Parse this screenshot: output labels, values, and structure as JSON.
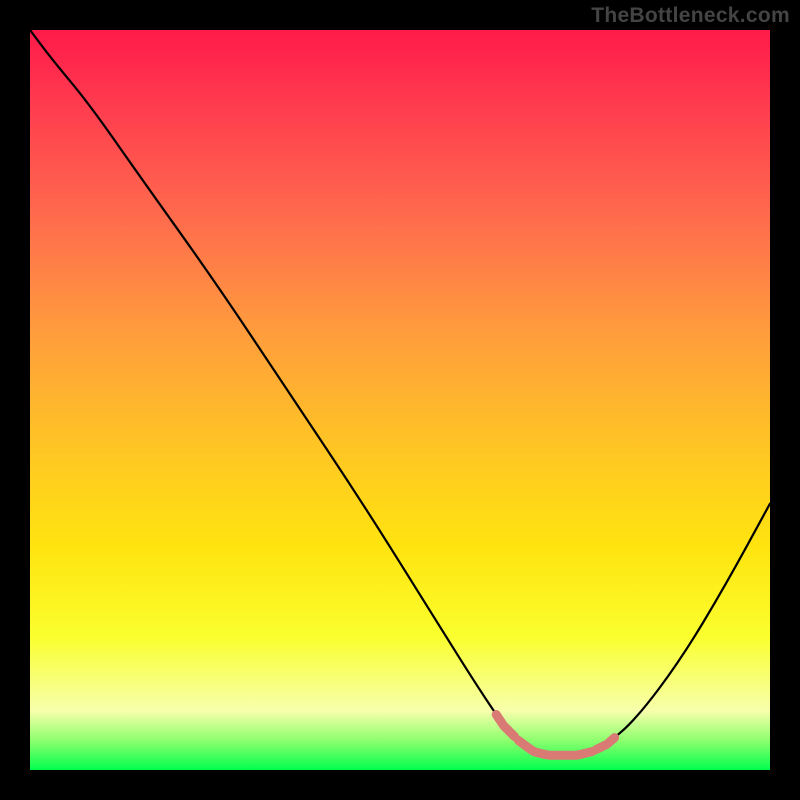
{
  "watermark": "TheBottleneck.com",
  "chart_data": {
    "type": "line",
    "title": "",
    "xlabel": "",
    "ylabel": "",
    "xlim": [
      0,
      100
    ],
    "ylim": [
      0,
      100
    ],
    "grid": false,
    "legend": false,
    "x": [
      0,
      3,
      8,
      15,
      25,
      35,
      45,
      55,
      60,
      64,
      66,
      68,
      70,
      72,
      74,
      76,
      78,
      82,
      88,
      94,
      100
    ],
    "values": [
      100,
      96,
      90,
      80,
      66,
      51,
      36,
      20,
      12,
      6,
      4,
      2.5,
      2,
      2,
      2,
      2.5,
      3.5,
      7,
      15,
      25,
      36
    ],
    "note": "Values estimated from pixel heights; y≈0 is green (bottom), y≈100 is red (top). V-shaped bottleneck curve with flat minimum around x≈66–76 and a highlighted segment there."
  },
  "colors": {
    "curve_stroke": "#000000",
    "highlight_stroke": "#d97a74"
  }
}
